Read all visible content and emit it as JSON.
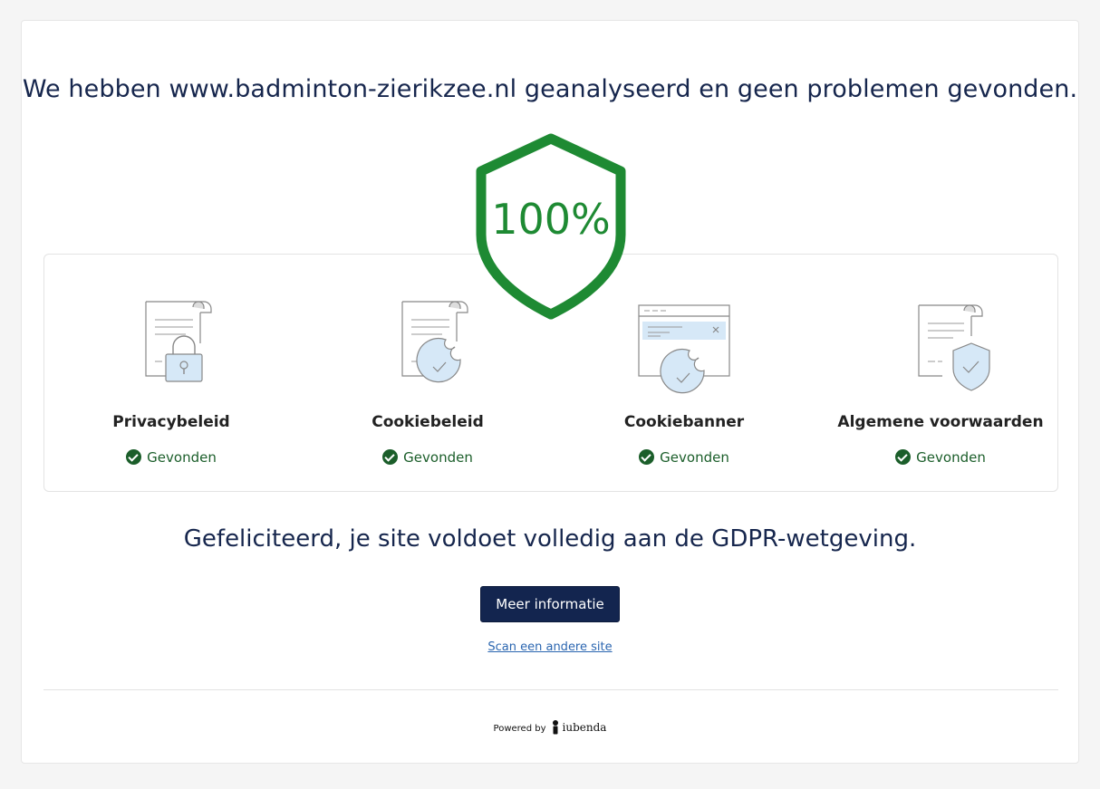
{
  "headline": "We hebben www.badminton-zierikzee.nl geanalyseerd en geen problemen gevonden.",
  "score": "100%",
  "checks": [
    {
      "title": "Privacybeleid",
      "status": "Gevonden",
      "icon": "privacy-policy-lock-icon"
    },
    {
      "title": "Cookiebeleid",
      "status": "Gevonden",
      "icon": "cookie-policy-icon"
    },
    {
      "title": "Cookiebanner",
      "status": "Gevonden",
      "icon": "cookie-banner-icon"
    },
    {
      "title": "Algemene voorwaarden",
      "status": "Gevonden",
      "icon": "terms-shield-icon"
    }
  ],
  "congrats": "Gefeliciteerd, je site voldoet volledig aan de GDPR-wetgeving.",
  "more_info_label": "Meer informatie",
  "scan_other_label": "Scan een andere site",
  "powered_by": "Powered by",
  "brand": "iubenda",
  "colors": {
    "navy": "#13254f",
    "success_green": "#1e8a33",
    "status_green": "#1b5e2a",
    "icon_fill": "#d6e8f7",
    "link": "#2b66b0"
  }
}
